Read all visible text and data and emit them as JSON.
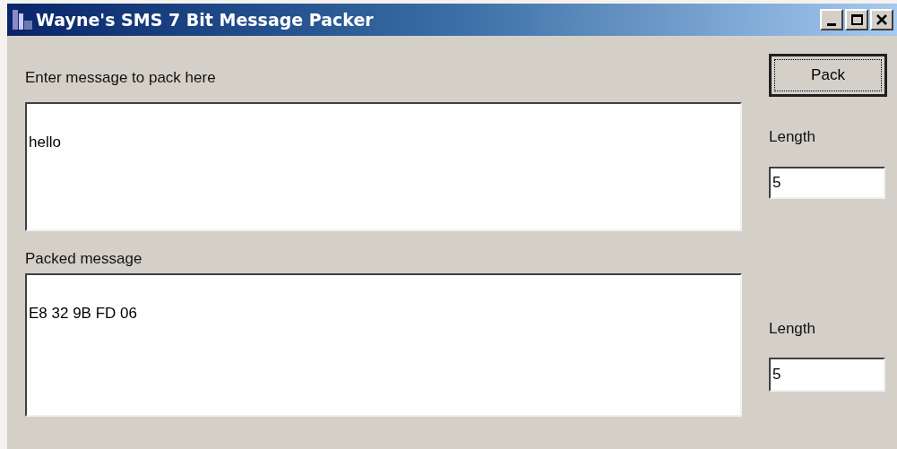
{
  "window": {
    "title": "Wayne's SMS 7 Bit Message Packer"
  },
  "input": {
    "label": "Enter message to pack here",
    "value": "hello"
  },
  "pack_button": {
    "label": "Pack",
    "focused": true
  },
  "input_length": {
    "label": "Length",
    "value": "5"
  },
  "output": {
    "label": "Packed message",
    "value": "E8 32 9B FD 06"
  },
  "output_length": {
    "label": "Length",
    "value": "5"
  }
}
